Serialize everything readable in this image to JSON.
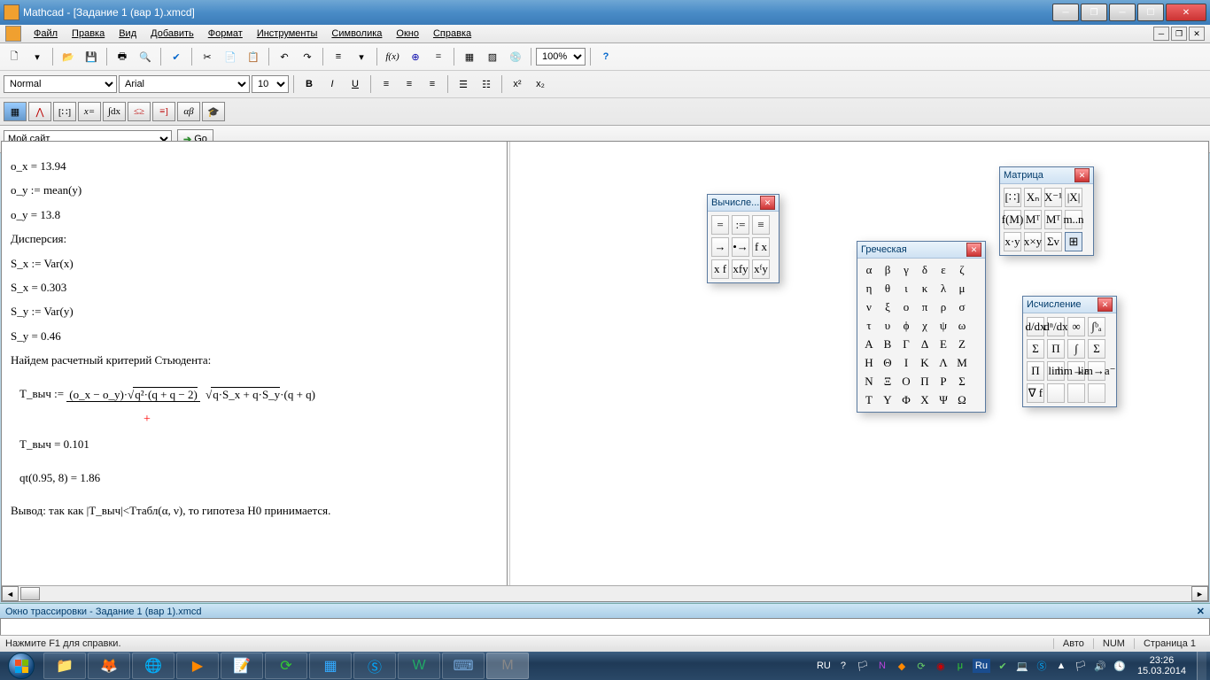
{
  "title": "Mathcad - [Задание 1 (вар 1).xmcd]",
  "menu": [
    "Файл",
    "Правка",
    "Вид",
    "Добавить",
    "Формат",
    "Инструменты",
    "Символика",
    "Окно",
    "Справка"
  ],
  "toolbar1": {
    "zoom": "100%"
  },
  "format": {
    "style": "Normal",
    "font": "Arial",
    "size": "10"
  },
  "go": {
    "site": "Мой сайт",
    "btn": "Go"
  },
  "doc": {
    "l1": "o_x = 13.94",
    "l2": "o_y := mean(y)",
    "l3": "o_y = 13.8",
    "l4": "Дисперсия:",
    "l5": "S_x := Var(x)",
    "l6": "S_x = 0.303",
    "l7": "S_y := Var(y)",
    "l8": "S_y = 0.46",
    "l9": "Найдем расчетный критерий Стьюдента:",
    "formula_lhs": "T_выч :=",
    "formula_num": "(o_x − o_y)·√q²·(q + q − 2)",
    "formula_num_left": "(o_x − o_y)·",
    "formula_num_right": "q²·(q + q − 2)",
    "formula_den_in": "q·S_x + q·S_y",
    "formula_den_right": "·(q + q)",
    "l10": "T_выч = 0.101",
    "l11": "qt(0.95, 8) = 1.86",
    "l12": "Вывод: так как |T_выч|<Tтабл(α, ν), то гипотеза H0 принимается."
  },
  "trace": "Окно трассировки - Задание 1 (вар 1).xmcd",
  "status": {
    "hint": "Нажмите F1 для справки.",
    "auto": "Авто",
    "num": "NUM",
    "page": "Страница 1"
  },
  "tray": {
    "lang": "RU",
    "time": "23:26",
    "date": "15.03.2014"
  },
  "pal_eval": {
    "title": "Вычисле...",
    "cells": [
      "=",
      ":=",
      "≡",
      "→",
      "•→",
      "f x",
      "x f",
      "xfy",
      "xᶠy"
    ]
  },
  "pal_greek": {
    "title": "Греческая",
    "cells": [
      "α",
      "β",
      "γ",
      "δ",
      "ε",
      "ζ",
      "η",
      "θ",
      "ι",
      "κ",
      "λ",
      "μ",
      "ν",
      "ξ",
      "ο",
      "π",
      "ρ",
      "σ",
      "τ",
      "υ",
      "ϕ",
      "χ",
      "ψ",
      "ω",
      "Α",
      "Β",
      "Γ",
      "Δ",
      "Ε",
      "Ζ",
      "Η",
      "Θ",
      "Ι",
      "Κ",
      "Λ",
      "Μ",
      "Ν",
      "Ξ",
      "Ο",
      "Π",
      "Ρ",
      "Σ",
      "Τ",
      "Υ",
      "Φ",
      "Χ",
      "Ψ",
      "Ω"
    ]
  },
  "pal_matrix": {
    "title": "Матрица",
    "cells": [
      "[∷]",
      "Xₙ",
      "X⁻¹",
      "|X|",
      "f(M)",
      "Mᵀ",
      "Mᵀ",
      "m..n",
      "x·y",
      "x×y",
      "Σv",
      "⊞"
    ]
  },
  "pal_calc": {
    "title": "Исчисление",
    "cells": [
      "d/dx",
      "dⁿ/dx",
      "∞",
      "∫ᵇₐ",
      "Σ",
      "Π",
      "∫",
      "Σ",
      "Π",
      "lim",
      "lim→a⁺",
      "lim→a⁻",
      "∇ f",
      "",
      "",
      ""
    ]
  }
}
